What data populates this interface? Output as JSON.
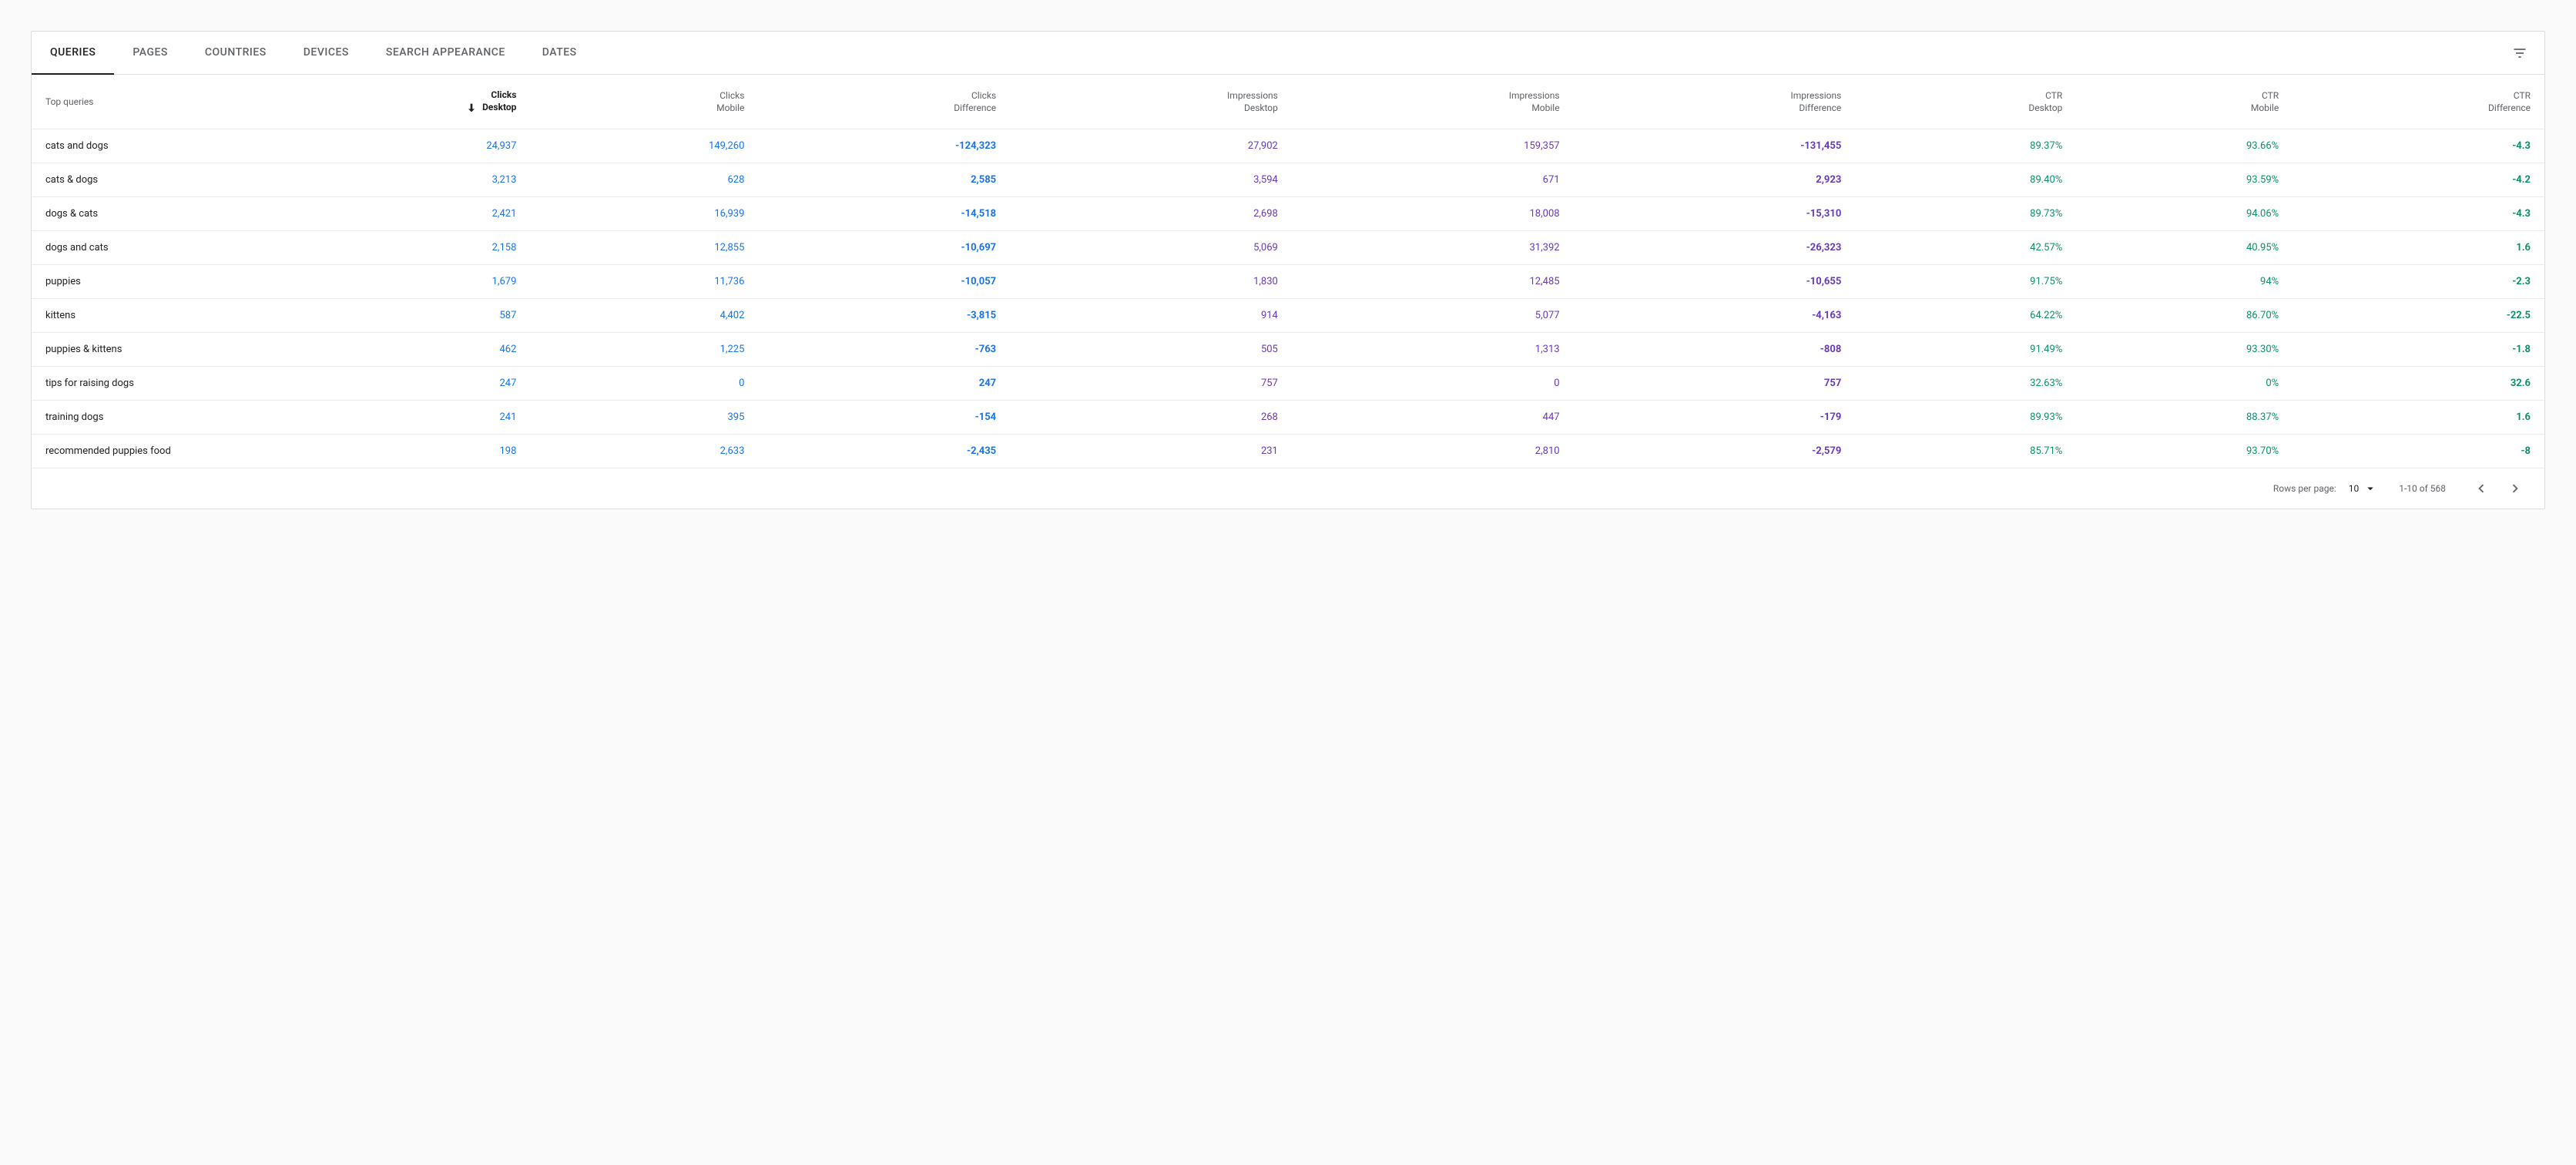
{
  "tabs": [
    {
      "label": "QUERIES",
      "active": true
    },
    {
      "label": "PAGES",
      "active": false
    },
    {
      "label": "COUNTRIES",
      "active": false
    },
    {
      "label": "DEVICES",
      "active": false
    },
    {
      "label": "SEARCH APPEARANCE",
      "active": false
    },
    {
      "label": "DATES",
      "active": false
    }
  ],
  "columns": [
    {
      "line1": "Top queries",
      "line2": ""
    },
    {
      "line1": "Clicks",
      "line2": "Desktop",
      "sorted": true
    },
    {
      "line1": "Clicks",
      "line2": "Mobile"
    },
    {
      "line1": "Clicks",
      "line2": "Difference"
    },
    {
      "line1": "Impressions",
      "line2": "Desktop"
    },
    {
      "line1": "Impressions",
      "line2": "Mobile"
    },
    {
      "line1": "Impressions",
      "line2": "Difference"
    },
    {
      "line1": "CTR",
      "line2": "Desktop"
    },
    {
      "line1": "CTR",
      "line2": "Mobile"
    },
    {
      "line1": "CTR",
      "line2": "Difference"
    }
  ],
  "rows": [
    {
      "query": "cats and dogs",
      "clicks_d": "24,937",
      "clicks_m": "149,260",
      "clicks_diff": "-124,323",
      "imp_d": "27,902",
      "imp_m": "159,357",
      "imp_diff": "-131,455",
      "ctr_d": "89.37%",
      "ctr_m": "93.66%",
      "ctr_diff": "-4.3"
    },
    {
      "query": "cats & dogs",
      "clicks_d": "3,213",
      "clicks_m": "628",
      "clicks_diff": "2,585",
      "imp_d": "3,594",
      "imp_m": "671",
      "imp_diff": "2,923",
      "ctr_d": "89.40%",
      "ctr_m": "93.59%",
      "ctr_diff": "-4.2"
    },
    {
      "query": "dogs & cats",
      "clicks_d": "2,421",
      "clicks_m": "16,939",
      "clicks_diff": "-14,518",
      "imp_d": "2,698",
      "imp_m": "18,008",
      "imp_diff": "-15,310",
      "ctr_d": "89.73%",
      "ctr_m": "94.06%",
      "ctr_diff": "-4.3"
    },
    {
      "query": "dogs and cats",
      "clicks_d": "2,158",
      "clicks_m": "12,855",
      "clicks_diff": "-10,697",
      "imp_d": "5,069",
      "imp_m": "31,392",
      "imp_diff": "-26,323",
      "ctr_d": "42.57%",
      "ctr_m": "40.95%",
      "ctr_diff": "1.6"
    },
    {
      "query": "puppies",
      "clicks_d": "1,679",
      "clicks_m": "11,736",
      "clicks_diff": "-10,057",
      "imp_d": "1,830",
      "imp_m": "12,485",
      "imp_diff": "-10,655",
      "ctr_d": "91.75%",
      "ctr_m": "94%",
      "ctr_diff": "-2.3"
    },
    {
      "query": "kittens",
      "clicks_d": "587",
      "clicks_m": "4,402",
      "clicks_diff": "-3,815",
      "imp_d": "914",
      "imp_m": "5,077",
      "imp_diff": "-4,163",
      "ctr_d": "64.22%",
      "ctr_m": "86.70%",
      "ctr_diff": "-22.5"
    },
    {
      "query": "puppies & kittens",
      "clicks_d": "462",
      "clicks_m": "1,225",
      "clicks_diff": "-763",
      "imp_d": "505",
      "imp_m": "1,313",
      "imp_diff": "-808",
      "ctr_d": "91.49%",
      "ctr_m": "93.30%",
      "ctr_diff": "-1.8"
    },
    {
      "query": "tips for raising dogs",
      "clicks_d": "247",
      "clicks_m": "0",
      "clicks_diff": "247",
      "imp_d": "757",
      "imp_m": "0",
      "imp_diff": "757",
      "ctr_d": "32.63%",
      "ctr_m": "0%",
      "ctr_diff": "32.6"
    },
    {
      "query": "training dogs",
      "clicks_d": "241",
      "clicks_m": "395",
      "clicks_diff": "-154",
      "imp_d": "268",
      "imp_m": "447",
      "imp_diff": "-179",
      "ctr_d": "89.93%",
      "ctr_m": "88.37%",
      "ctr_diff": "1.6"
    },
    {
      "query": "recommended puppies food",
      "clicks_d": "198",
      "clicks_m": "2,633",
      "clicks_diff": "-2,435",
      "imp_d": "231",
      "imp_m": "2,810",
      "imp_diff": "-2,579",
      "ctr_d": "85.71%",
      "ctr_m": "93.70%",
      "ctr_diff": "-8"
    }
  ],
  "pager": {
    "rows_label": "Rows per page:",
    "rows_value": "10",
    "range": "1-10 of 568"
  }
}
